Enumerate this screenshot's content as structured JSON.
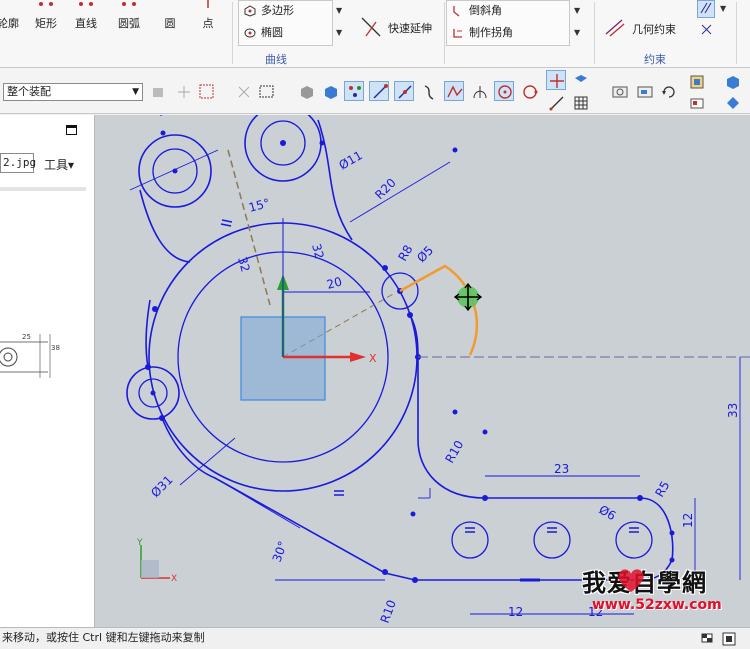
{
  "ribbon": {
    "tools": [
      "轮廓",
      "矩形",
      "直线",
      "圆弧",
      "圆",
      "点"
    ],
    "tools_display": [
      "轮廓",
      "矩形",
      "直线",
      "圆弧",
      "圆",
      "点"
    ],
    "curve_items": {
      "polygon": "多边形",
      "ellipse": "椭圆",
      "quick_extend": "快速延伸",
      "chamfer": "倒斜角",
      "make_corner": "制作拐角"
    },
    "group_curve": "曲线",
    "geometric_constraint": "几何约束",
    "group_constraint": "约束"
  },
  "toolbar": {
    "assembly_filter": "整个装配"
  },
  "navigator": {
    "file_field": "2.jpg",
    "tools_menu": "工具▾"
  },
  "drawing": {
    "dimensions": [
      "Ø11",
      "R20",
      "15°",
      "32",
      "32",
      "20",
      "Ø5",
      "R8",
      "33",
      "R10",
      "23",
      "R5",
      "Ø6",
      "12",
      "Ø31",
      "30°",
      "R10",
      "12",
      "12"
    ],
    "axis_labels": {
      "x": "X",
      "y": "Y"
    },
    "mini_sketch_dims": [
      "25",
      "38"
    ]
  },
  "statusbar": {
    "message": "来移动，或按住 Ctrl 键和左键拖动来复制"
  },
  "watermark": {
    "title": "我爱自學網",
    "url": "www.52zxw.com"
  },
  "colors": {
    "sketch": "#1a1adb",
    "canvas_bg": "#cbd0d5",
    "highlight": "#f29a2e",
    "axis_x": "#e03030",
    "axis_y": "#2aa02a",
    "group_label": "#3b5bab"
  }
}
